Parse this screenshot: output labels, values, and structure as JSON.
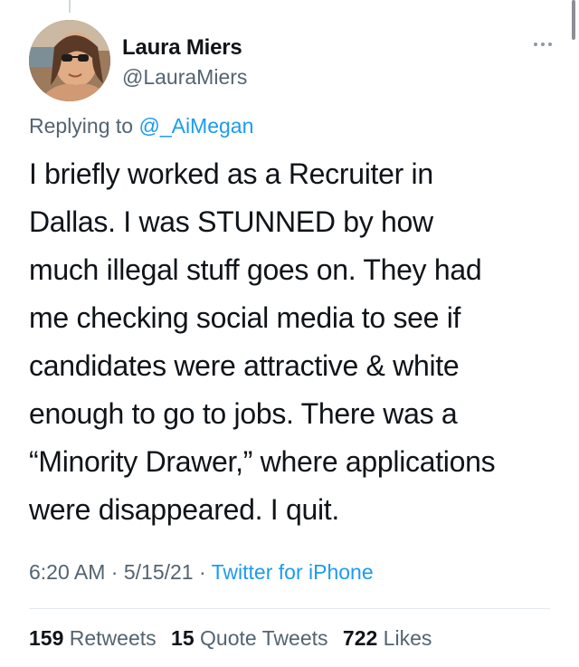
{
  "author": {
    "display_name": "Laura Miers",
    "handle": "@LauraMiers"
  },
  "reply": {
    "prefix": "Replying to",
    "mention": "@_AiMegan"
  },
  "tweet": {
    "lines": [
      "I briefly worked as a Recruiter in",
      "Dallas. I was STUNNED by how",
      "much illegal stuff goes on. They had",
      "me checking social media to see if",
      "candidates were attractive & white",
      "enough to go to jobs. There was a",
      "“Minority Drawer,” where applications",
      "were disappeared. I quit."
    ]
  },
  "meta": {
    "time": "6:20 AM",
    "separator": "·",
    "date": "5/15/21",
    "source": "Twitter for iPhone"
  },
  "stats": {
    "retweets_count": "159",
    "retweets_label": "Retweets",
    "quotes_count": "15",
    "quotes_label": "Quote Tweets",
    "likes_count": "722",
    "likes_label": "Likes"
  },
  "icons": {
    "more": "more-options-icon",
    "avatar": "profile-photo"
  },
  "colors": {
    "link": "#1d9bf0",
    "secondary": "#536471",
    "primary": "#0f1419"
  }
}
